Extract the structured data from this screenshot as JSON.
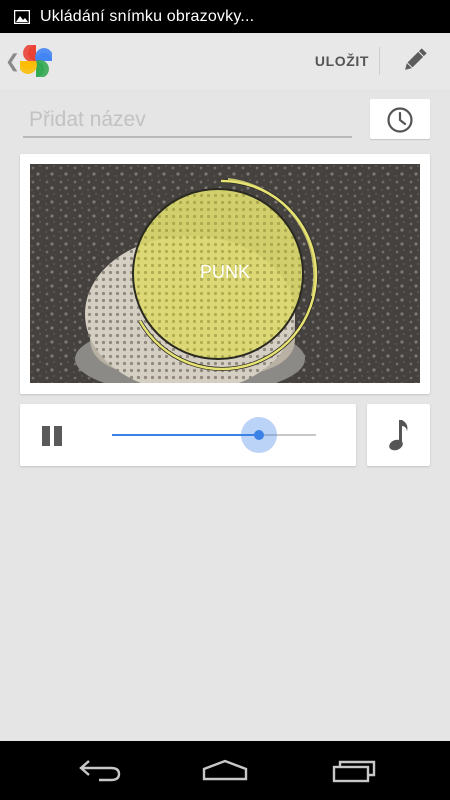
{
  "status_bar": {
    "notification_text": "Ukládání snímku obrazovky...",
    "notification_icon": "image-icon"
  },
  "action_bar": {
    "up_icon": "chevron-left-icon",
    "app_icon": "google-photos-pinwheel-icon",
    "save_label": "ULOŽIT",
    "edit_icon": "pencil-icon"
  },
  "title_field": {
    "placeholder": "Přidat název",
    "value": ""
  },
  "clock_button": {
    "icon": "clock-icon"
  },
  "preview": {
    "theme_label": "PUNK",
    "theme_color": "#e6e274"
  },
  "player": {
    "pause_icon": "pause-icon",
    "progress": 0.72,
    "accent_color": "#3b82e6",
    "music_icon": "music-note-icon"
  },
  "nav_bar": {
    "back_icon": "back-icon",
    "home_icon": "home-icon",
    "recents_icon": "recents-icon"
  }
}
